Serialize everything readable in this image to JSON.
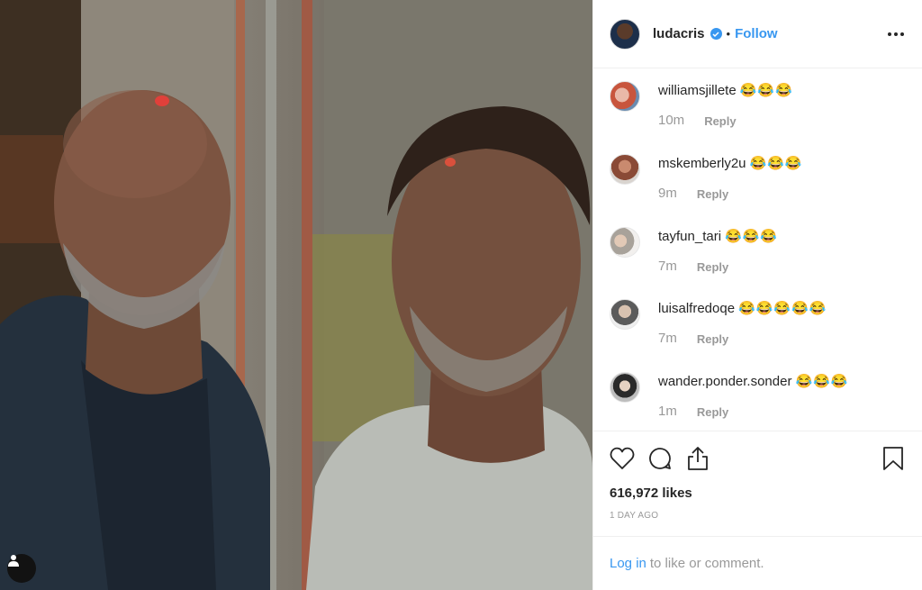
{
  "post": {
    "author": "ludacris",
    "follow_label": "Follow",
    "separator": "•",
    "likes": "616,972 likes",
    "date": "1 DAY AGO",
    "login_link": "Log in",
    "login_rest": "to like or comment."
  },
  "comments": [
    {
      "user": "williamsjillete",
      "text": "😂😂😂",
      "time": "10m",
      "reply": "Reply",
      "avatar_color": "#c8553d"
    },
    {
      "user": "mskemberly2u",
      "text": "😂😂😂",
      "time": "9m",
      "reply": "Reply",
      "avatar_color": "#8a4a36"
    },
    {
      "user": "tayfun_tari",
      "text": "😂😂😂",
      "time": "7m",
      "reply": "Reply",
      "avatar_color": "#a8a29a"
    },
    {
      "user": "luisalfredoqe",
      "text": "😂😂😂😂😂",
      "time": "7m",
      "reply": "Reply",
      "avatar_color": "#5b5b5b"
    },
    {
      "user": "wander.ponder.sonder",
      "text": "😂😂😂",
      "time": "1m",
      "reply": "Reply",
      "avatar_color": "#9d9d9d"
    }
  ],
  "icons": {
    "verified": "verified-badge-icon",
    "more": "more-options-icon",
    "like": "heart-icon",
    "comment": "comment-icon",
    "share": "share-icon",
    "save": "bookmark-icon",
    "tag": "user-tag-icon"
  },
  "colors": {
    "accent": "#3897f0",
    "muted": "#999999",
    "text": "#262626"
  }
}
